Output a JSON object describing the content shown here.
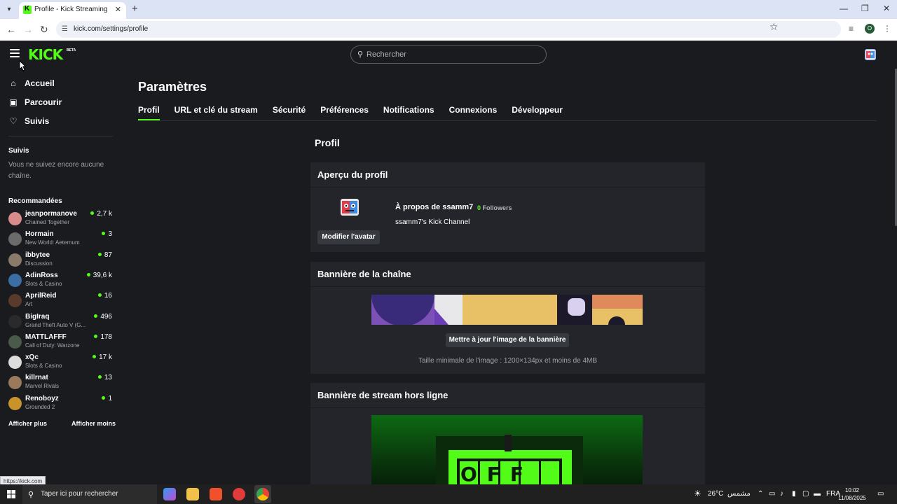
{
  "browser": {
    "tab_title": "Profile - Kick Streaming",
    "url": "kick.com/settings/profile",
    "status_url": "https://kick.com"
  },
  "header": {
    "logo": "KICK",
    "logo_badge": "BETA",
    "search_placeholder": "Rechercher"
  },
  "sidebar": {
    "nav": [
      {
        "label": "Accueil",
        "icon": "home-icon"
      },
      {
        "label": "Parcourir",
        "icon": "browse-icon"
      },
      {
        "label": "Suivis",
        "icon": "heart-icon"
      }
    ],
    "following_title": "Suivis",
    "following_empty": "Vous ne suivez encore aucune chaîne.",
    "recommended_title": "Recommandées",
    "recommended": [
      {
        "name": "jeanpormanove",
        "category": "Chained Together",
        "viewers": "2,7 k",
        "color": "#d98b8b"
      },
      {
        "name": "Hormain",
        "category": "New World: Aeternum",
        "viewers": "3",
        "color": "#6b6b6b"
      },
      {
        "name": "ibbytee",
        "category": "Discussion",
        "viewers": "87",
        "color": "#8a7a6a"
      },
      {
        "name": "AdinRoss",
        "category": "Slots & Casino",
        "viewers": "39,6 k",
        "color": "#3b6ea5"
      },
      {
        "name": "AprilReid",
        "category": "Art",
        "viewers": "16",
        "color": "#5a3a2a"
      },
      {
        "name": "BigIraq",
        "category": "Grand Theft Auto V (G...",
        "viewers": "496",
        "color": "#2a2a2a"
      },
      {
        "name": "MATTLAFFF",
        "category": "Call of Duty: Warzone",
        "viewers": "178",
        "color": "#4a5a4a"
      },
      {
        "name": "xQc",
        "category": "Slots & Casino",
        "viewers": "17 k",
        "color": "#dcdcdc"
      },
      {
        "name": "killrnat",
        "category": "Marvel Rivals",
        "viewers": "13",
        "color": "#9a7a5a"
      },
      {
        "name": "Renoboyz",
        "category": "Grounded 2",
        "viewers": "1",
        "color": "#c9922a"
      }
    ],
    "show_more": "Afficher plus",
    "show_less": "Afficher moins"
  },
  "main": {
    "page_title": "Paramètres",
    "tabs": [
      "Profil",
      "URL et clé du stream",
      "Sécurité",
      "Préférences",
      "Notifications",
      "Connexions",
      "Développeur"
    ],
    "active_tab": "Profil",
    "section_heading": "Profil",
    "profile_card": {
      "title": "Aperçu du profil",
      "edit_avatar": "Modifier l'avatar",
      "about_title": "À propos de ssamm7",
      "followers_count": "0",
      "followers_label": "Followers",
      "about_desc": "ssamm7's Kick Channel"
    },
    "banner_card": {
      "title": "Bannière de la chaîne",
      "update_button": "Mettre à jour l'image de la bannière",
      "hint": "Taille minimale de l'image : 1200×134px et moins de 4MB"
    },
    "offline_card": {
      "title": "Bannière de stream hors ligne",
      "offline_text": "OFF"
    }
  },
  "taskbar": {
    "search_text": "Taper ici pour rechercher",
    "weather_temp": "26°C",
    "weather_desc": "مشمس",
    "lang": "FRA",
    "time": "10:02",
    "date": "11/08/2025"
  },
  "colors": {
    "accent": "#53fc18",
    "background": "#191b1f",
    "card": "#23252a"
  }
}
